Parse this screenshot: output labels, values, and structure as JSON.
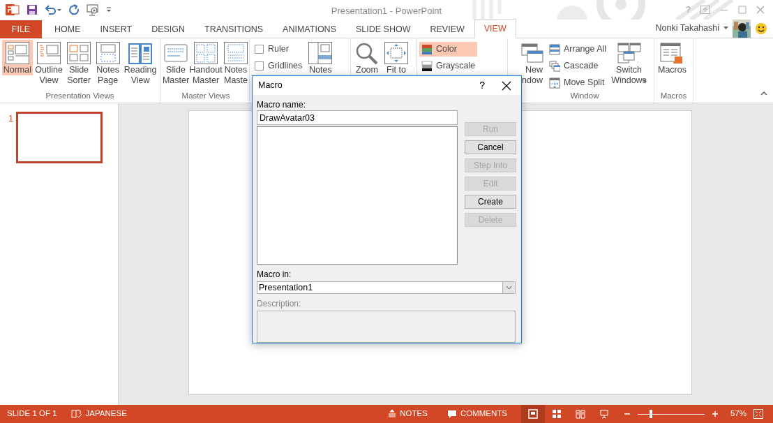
{
  "title_bar": {
    "title": "Presentation1 - PowerPoint",
    "help": "?"
  },
  "tabs": [
    {
      "label": "FILE",
      "kind": "file",
      "selected": false
    },
    {
      "label": "HOME",
      "kind": "tab",
      "selected": false
    },
    {
      "label": "INSERT",
      "kind": "tab",
      "selected": false
    },
    {
      "label": "DESIGN",
      "kind": "tab",
      "selected": false
    },
    {
      "label": "TRANSITIONS",
      "kind": "tab",
      "selected": false
    },
    {
      "label": "ANIMATIONS",
      "kind": "tab",
      "selected": false
    },
    {
      "label": "SLIDE SHOW",
      "kind": "tab",
      "selected": false
    },
    {
      "label": "REVIEW",
      "kind": "tab",
      "selected": false
    },
    {
      "label": "VIEW",
      "kind": "tab",
      "selected": true
    }
  ],
  "account": {
    "user": "Nonki Takahashi"
  },
  "ribbon": {
    "groups": [
      {
        "label": "Presentation Views",
        "items": [
          {
            "kind": "large",
            "lines": [
              "Normal"
            ],
            "selected": true
          },
          {
            "kind": "large",
            "lines": [
              "Outline",
              "View"
            ],
            "selected": false
          },
          {
            "kind": "large",
            "lines": [
              "Slide",
              "Sorter"
            ],
            "selected": false
          },
          {
            "kind": "large",
            "lines": [
              "Notes",
              "Page"
            ],
            "selected": false
          },
          {
            "kind": "large",
            "lines": [
              "Reading",
              "View"
            ],
            "selected": false
          }
        ]
      },
      {
        "label": "Master Views",
        "items": [
          {
            "kind": "large",
            "lines": [
              "Slide",
              "Master"
            ]
          },
          {
            "kind": "large",
            "lines": [
              "Handout",
              "Master"
            ]
          },
          {
            "kind": "large",
            "lines": [
              "Notes",
              "Maste"
            ]
          }
        ]
      },
      {
        "items": [
          {
            "kind": "stack",
            "items": [
              {
                "kind": "check",
                "label": "Ruler",
                "checked": false
              },
              {
                "kind": "check",
                "label": "Gridlines",
                "checked": false
              }
            ]
          },
          {
            "kind": "large",
            "lines": [
              "Notes"
            ]
          }
        ]
      },
      {
        "items": [
          {
            "kind": "large",
            "lines": [
              "Zoom"
            ]
          },
          {
            "kind": "large",
            "lines": [
              "Fit to"
            ]
          }
        ]
      },
      {
        "items": [
          {
            "kind": "stack",
            "items": [
              {
                "kind": "small",
                "label": "Color",
                "selected": true
              },
              {
                "kind": "small",
                "label": "Grayscale",
                "selected": false
              }
            ]
          }
        ]
      },
      {
        "label": "Window",
        "items": [
          {
            "kind": "large",
            "lines": [
              "New",
              "ndow"
            ]
          },
          {
            "kind": "stack",
            "items": [
              {
                "kind": "small",
                "label": "Arrange All"
              },
              {
                "kind": "small",
                "label": "Cascade"
              },
              {
                "kind": "small",
                "label": "Move Split"
              }
            ]
          },
          {
            "kind": "large",
            "lines": [
              "Switch",
              "Windows"
            ],
            "dropdown": true
          }
        ]
      },
      {
        "label": "Macros",
        "items": [
          {
            "kind": "large",
            "lines": [
              "Macros"
            ]
          }
        ]
      }
    ]
  },
  "slides": [
    {
      "number": "1",
      "selected": true
    }
  ],
  "dialog": {
    "title": "Macro",
    "help": "?",
    "name_label": "Macro name:",
    "name_value": "DrawAvatar03",
    "buttons": [
      {
        "label": "Run",
        "disabled": true
      },
      {
        "label": "Cancel",
        "disabled": false
      },
      {
        "label": "Step Into",
        "disabled": true
      },
      {
        "label": "Edit",
        "disabled": true
      },
      {
        "label": "Create",
        "disabled": false
      },
      {
        "label": "Delete",
        "disabled": true
      }
    ],
    "macro_in_label": "Macro in:",
    "macro_in_value": "Presentation1",
    "description_label": "Description:",
    "description_disabled": true
  },
  "status_bar": {
    "slide_info": "SLIDE 1 OF 1",
    "language": "JAPANESE",
    "notes": "NOTES",
    "comments": "COMMENTS",
    "views": [
      {
        "selected": true
      },
      {
        "selected": false
      },
      {
        "selected": false
      },
      {
        "selected": false
      }
    ],
    "zoom": {
      "level": 0.2,
      "reading": "57%"
    }
  }
}
